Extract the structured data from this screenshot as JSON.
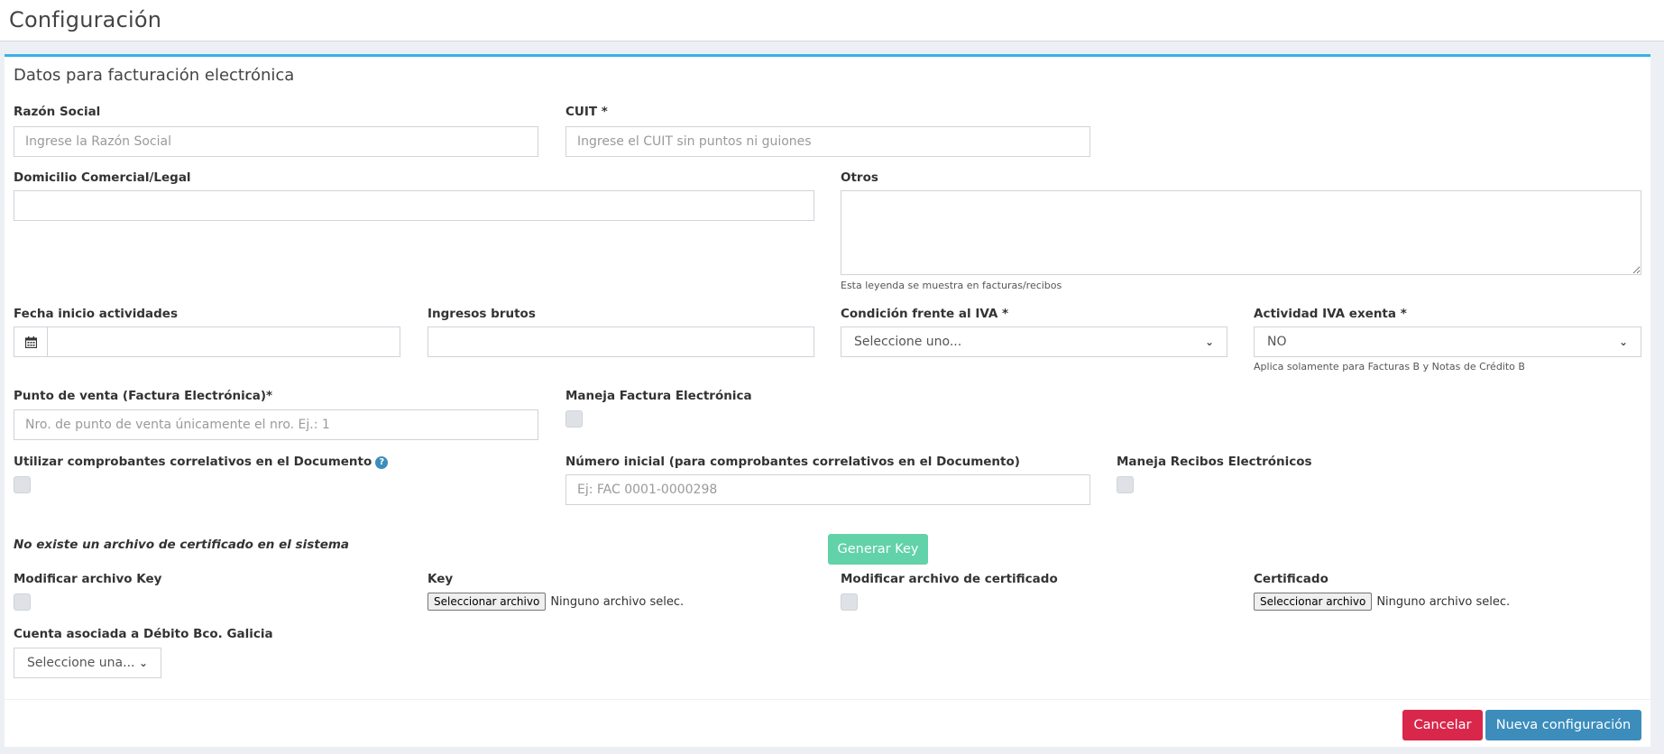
{
  "header": {
    "title": "Configuración"
  },
  "box": {
    "title": "Datos para facturación electrónica"
  },
  "fields": {
    "razon_social": {
      "label": "Razón Social",
      "placeholder": "Ingrese la Razón Social",
      "value": ""
    },
    "cuit": {
      "label": "CUIT *",
      "placeholder": "Ingrese el CUIT sin puntos ni guiones",
      "value": ""
    },
    "domicilio": {
      "label": "Domicilio Comercial/Legal",
      "value": ""
    },
    "otros": {
      "label": "Otros",
      "help": "Esta leyenda se muestra en facturas/recibos",
      "value": ""
    },
    "fecha_inicio": {
      "label": "Fecha inicio actividades",
      "value": "",
      "icon": "calendar-icon"
    },
    "ingresos_brutos": {
      "label": "Ingresos brutos",
      "value": ""
    },
    "condicion_iva": {
      "label": "Condición frente al IVA *",
      "selected": "Seleccione uno..."
    },
    "actividad_iva_exenta": {
      "label": "Actividad IVA exenta *",
      "selected": "NO",
      "help": "Aplica solamente para Facturas B y Notas de Crédito B"
    },
    "punto_venta": {
      "label": "Punto de venta (Factura Electrónica)*",
      "placeholder": "Nro. de punto de venta únicamente el nro. Ej.: 1",
      "value": ""
    },
    "maneja_factura": {
      "label": "Maneja Factura Electrónica",
      "checked": false
    },
    "comprobantes_correlativos": {
      "label": "Utilizar comprobantes correlativos en el Documento",
      "info_icon": "question-icon",
      "info_glyph": "?",
      "checked": false
    },
    "numero_inicial": {
      "label": "Número inicial (para comprobantes correlativos en el Documento)",
      "placeholder": "Ej: FAC 0001-0000298",
      "value": ""
    },
    "maneja_recibos": {
      "label": "Maneja Recibos Electrónicos",
      "checked": false
    },
    "certificado_note": "No existe un archivo de certificado en el sistema",
    "generar_key_label": "Generar Key",
    "modificar_key": {
      "label": "Modificar archivo Key",
      "checked": false
    },
    "key_file": {
      "label": "Key",
      "button": "Seleccionar archivo",
      "status": "Ninguno archivo selec."
    },
    "modificar_certificado": {
      "label": "Modificar archivo de certificado",
      "checked": false
    },
    "certificado_file": {
      "label": "Certificado",
      "button": "Seleccionar archivo",
      "status": "Ninguno archivo selec."
    },
    "cuenta_debito": {
      "label": "Cuenta asociada a Débito Bco. Galicia",
      "selected": "Seleccione una..."
    }
  },
  "actions": {
    "cancel": "Cancelar",
    "submit": "Nueva configuración"
  },
  "colors": {
    "accent_top": "#3ab0e8",
    "generar_key": "#62d2a8",
    "cancel": "#d9274b",
    "submit": "#3c8dbc"
  }
}
